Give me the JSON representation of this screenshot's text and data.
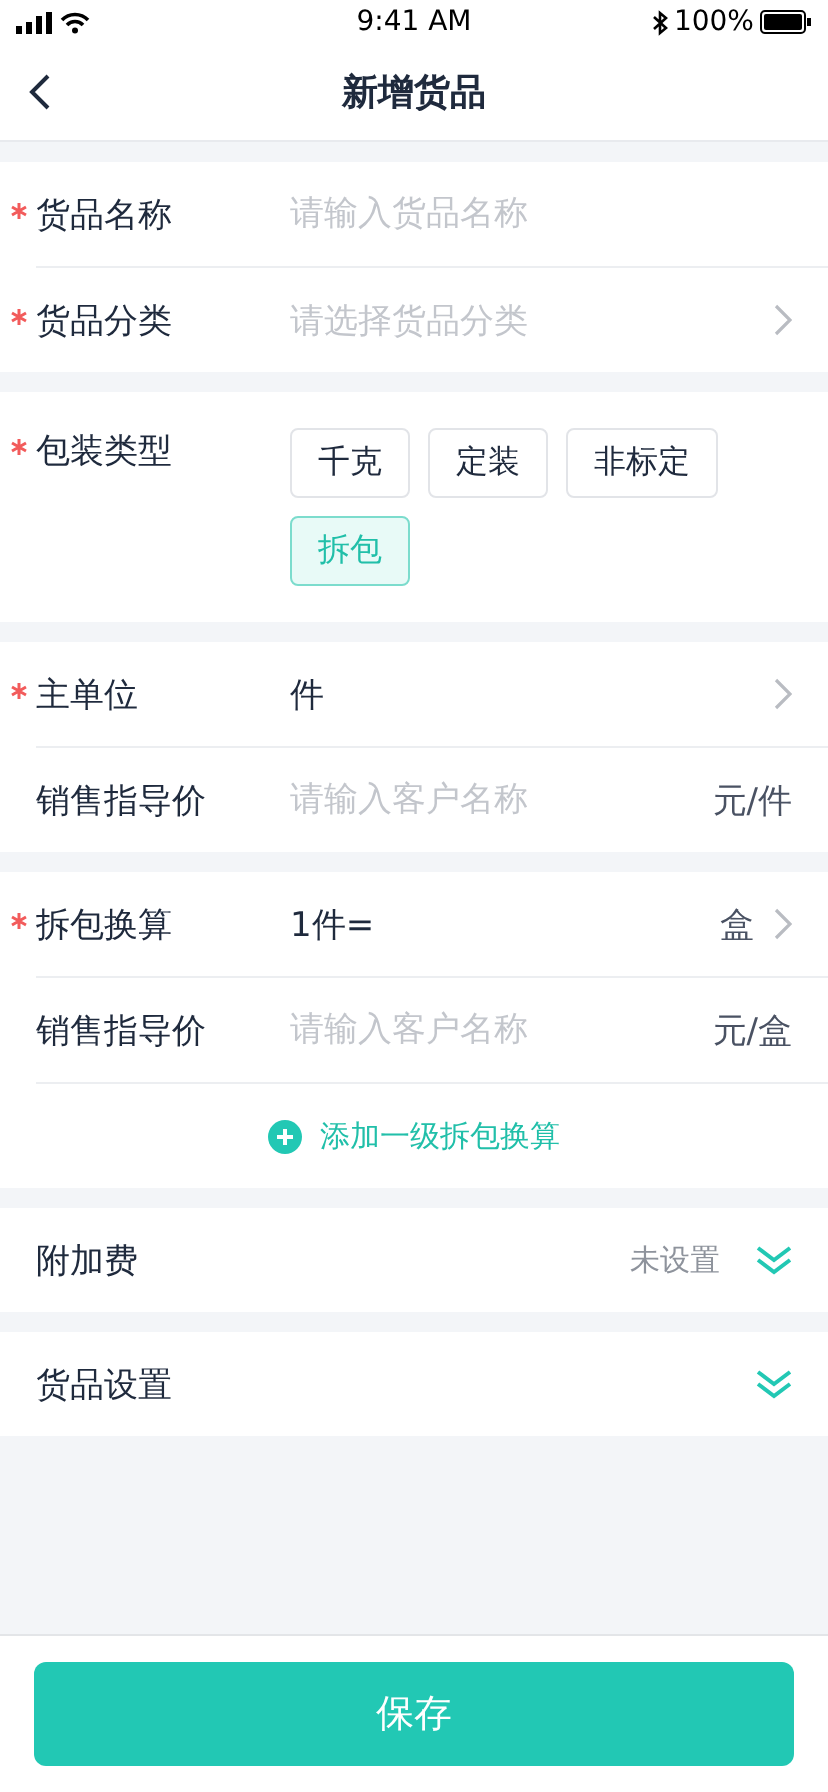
{
  "status_bar": {
    "time": "9:41 AM",
    "battery": "100%"
  },
  "nav": {
    "title": "新增货品"
  },
  "sections": [
    {
      "rows": [
        {
          "kind": "input",
          "label": "货品名称",
          "required": true,
          "placeholder": "请输入货品名称"
        },
        {
          "kind": "select",
          "label": "货品分类",
          "required": true,
          "placeholder": "请选择货品分类"
        }
      ]
    },
    {
      "rows": [
        {
          "kind": "tags",
          "label": "包装类型",
          "required": true,
          "tags": [
            {
              "label": "千克",
              "selected": false
            },
            {
              "label": "定装",
              "selected": false
            },
            {
              "label": "非标定",
              "selected": false
            },
            {
              "label": "拆包",
              "selected": true
            }
          ]
        }
      ]
    },
    {
      "rows": [
        {
          "kind": "select",
          "label": "主单位",
          "required": true,
          "value": "件"
        },
        {
          "kind": "input",
          "label": "销售指导价",
          "required": false,
          "placeholder": "请输入客户名称",
          "unit": "元/件"
        }
      ]
    },
    {
      "rows": [
        {
          "kind": "select",
          "label": "拆包换算",
          "required": true,
          "value": "1件=",
          "unit": "盒"
        },
        {
          "kind": "input",
          "label": "销售指导价",
          "required": false,
          "placeholder": "请输入客户名称",
          "unit": "元/盒"
        },
        {
          "kind": "add",
          "label": "添加一级拆包换算"
        }
      ]
    },
    {
      "rows": [
        {
          "kind": "collapse",
          "label": "附加费",
          "status": "未设置"
        }
      ]
    },
    {
      "rows": [
        {
          "kind": "collapse",
          "label": "货品设置"
        }
      ]
    }
  ],
  "save_button": "保存"
}
